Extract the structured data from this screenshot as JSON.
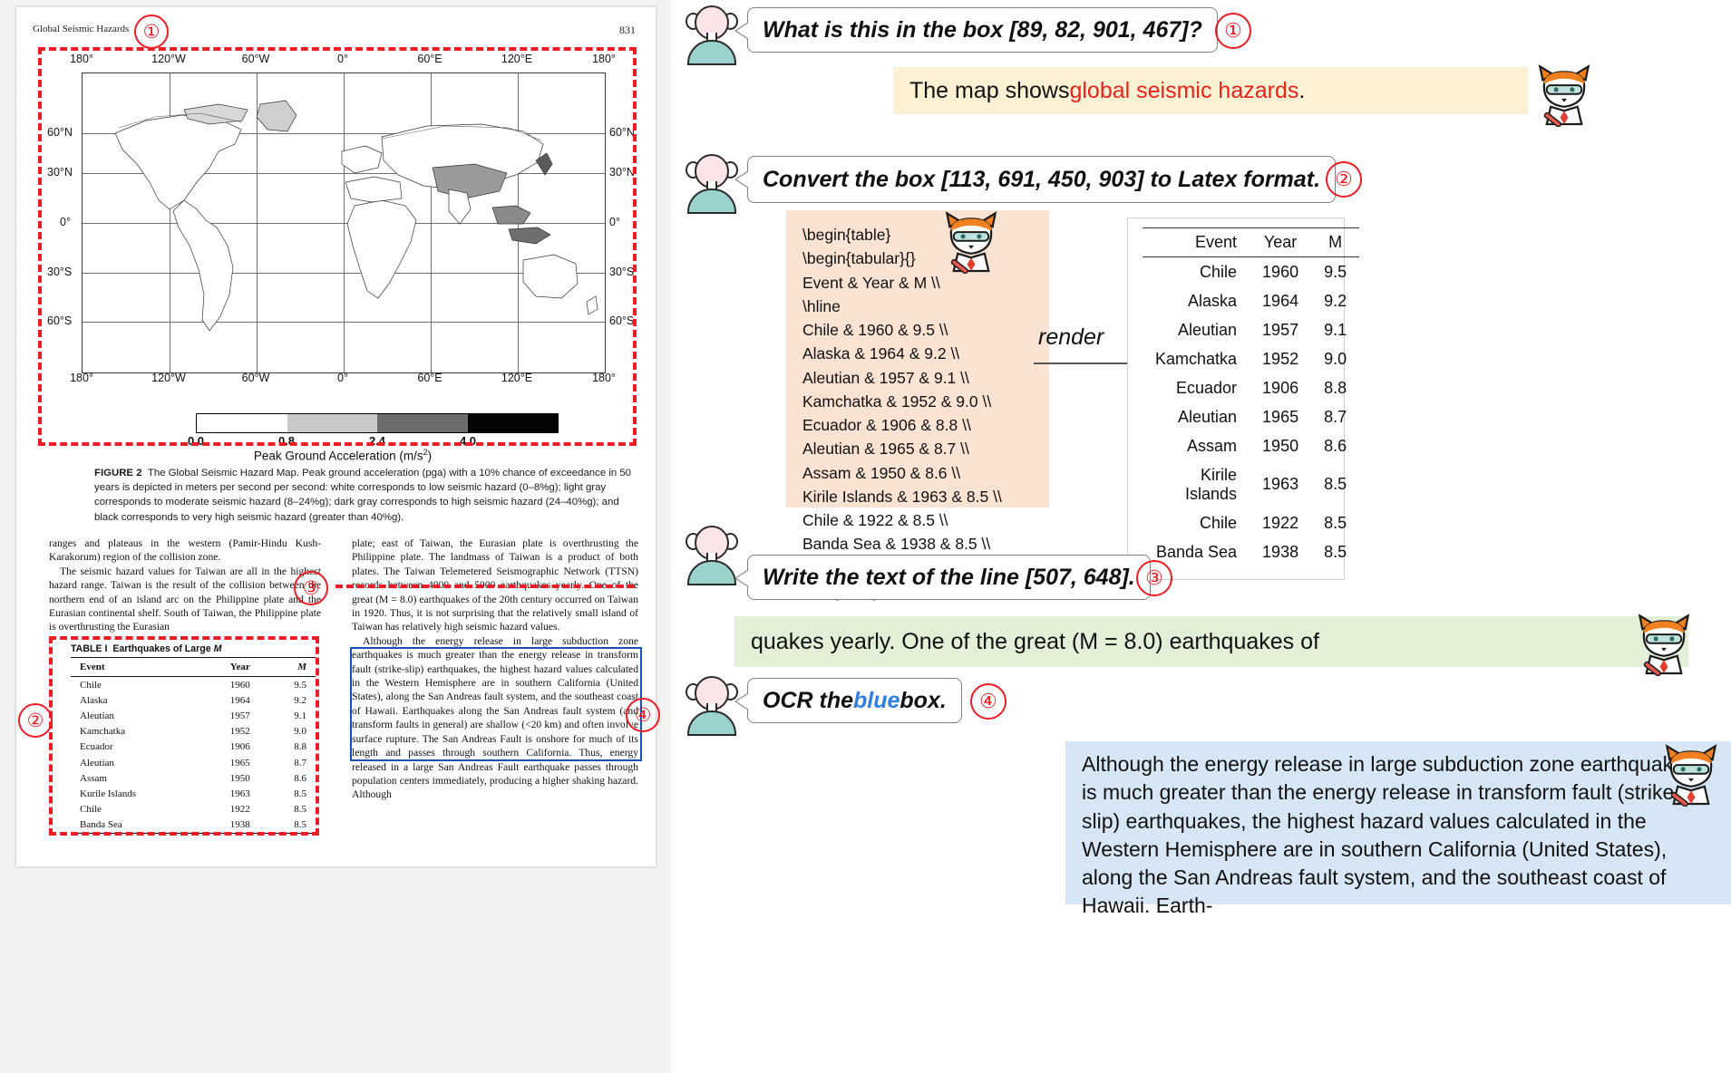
{
  "document": {
    "running_head": "Global Seismic Hazards",
    "page_number": "831",
    "figure": {
      "lon_labels": [
        "180°",
        "120°W",
        "60°W",
        "0°",
        "60°E",
        "120°E",
        "180°"
      ],
      "lat_labels_left": [
        "60°N",
        "30°N",
        "0°",
        "30°S",
        "60°S"
      ],
      "lat_labels_right": [
        "60°N",
        "30°N",
        "0°",
        "30°S",
        "60°S"
      ],
      "colorbar_ticks": [
        "0.0",
        "0.8",
        "2.4",
        "4.0"
      ],
      "colorbar_title": "Peak Ground Acceleration (m/s",
      "colorbar_title_sup": "2",
      "colorbar_title_end": ")",
      "caption_label": "FIGURE 2",
      "caption_text": "The Global Seismic Hazard Map. Peak ground acceleration (pga) with a 10% chance of exceedance in 50 years is depicted in meters per second per second: white corresponds to low seismic hazard (0–8%g); light gray corresponds to moderate seismic hazard (8–24%g); dark gray corresponds to high seismic hazard (24–40%g); and black corresponds to very high seismic hazard (greater than 40%g)."
    },
    "column_left": [
      "ranges and plateaus in the western (Pamir-Hindu Kush-Karakorum) region of the collision zone.",
      "The seismic hazard values for Taiwan are all in the highest hazard range. Taiwan is the result of the collision between the northern end of an island arc on the Philippine plate and the Eurasian continental shelf. South of Taiwan, the Philippine plate is overthrusting the Eurasian"
    ],
    "column_right": [
      "plate; east of Taiwan, the Eurasian plate is overthrusting the Philippine plate. The landmass of Taiwan is a product of both plates. The Taiwan Telemetered Seismographic Network (TTSN) records between 4000 and 5000 earthquakes yearly. One of the great (M = 8.0) earthquakes of the 20th century occurred on Taiwan in 1920. Thus, it is not surprising that the relatively small island of Taiwan has relatively high seismic hazard values.",
      "Although the energy release in large subduction zone earthquakes is much greater than the energy release in transform fault (strike-slip) earthquakes, the highest hazard values calculated in the Western Hemisphere are in southern California (United States), along the San Andreas fault system, and the southeast coast of Hawaii. Earthquakes along the San Andreas fault system (and transform faults in general) are shallow (<20 km) and often involve surface rupture. The San Andreas Fault is onshore for much of its length and passes through southern California. Thus, energy released in a large San Andreas Fault earthquake passes through population centers immediately, producing a higher shaking hazard. Although"
    ],
    "table": {
      "caption_prefix": "TABLE I",
      "caption_text": "Earthquakes of Large ",
      "caption_italic": "M",
      "headers": [
        "Event",
        "Year",
        "M"
      ],
      "rows": [
        [
          "Chile",
          "1960",
          "9.5"
        ],
        [
          "Alaska",
          "1964",
          "9.2"
        ],
        [
          "Aleutian",
          "1957",
          "9.1"
        ],
        [
          "Kamchatka",
          "1952",
          "9.0"
        ],
        [
          "Ecuador",
          "1906",
          "8.8"
        ],
        [
          "Aleutian",
          "1965",
          "8.7"
        ],
        [
          "Assam",
          "1950",
          "8.6"
        ],
        [
          "Kurile Islands",
          "1963",
          "8.5"
        ],
        [
          "Chile",
          "1922",
          "8.5"
        ],
        [
          "Banda Sea",
          "1938",
          "8.5"
        ]
      ]
    },
    "markers": [
      "①",
      "②",
      "③",
      "④"
    ]
  },
  "chat": {
    "turn1": {
      "marker": "①",
      "question": "What is this in the box [89, 82, 901, 467]?",
      "answer_prefix": "The map shows ",
      "answer_highlight": "global seismic hazards",
      "answer_suffix": "."
    },
    "turn2": {
      "marker": "②",
      "question": "Convert the box [113, 691, 450, 903] to Latex format.",
      "code": "\\begin{table}\n\\begin{tabular}{}\nEvent & Year & M \\\\\n\\hline\nChile & 1960 & 9.5 \\\\\nAlaska & 1964 & 9.2 \\\\\nAleutian & 1957 & 9.1 \\\\\nKamchatka & 1952 & 9.0 \\\\\nEcuador & 1906 & 8.8 \\\\\nAleutian & 1965 & 8.7 \\\\\nAssam & 1950 & 8.6 \\\\\nKirile Islands & 1963 & 8.5 \\\\\nChile & 1922 & 8.5 \\\\\nBanda Sea & 1938 & 8.5 \\\\\n\\end{tabular}\n\\end{table}",
      "render_label": "render",
      "rendered_table": {
        "headers": [
          "Event",
          "Year",
          "M"
        ],
        "rows": [
          [
            "Chile",
            "1960",
            "9.5"
          ],
          [
            "Alaska",
            "1964",
            "9.2"
          ],
          [
            "Aleutian",
            "1957",
            "9.1"
          ],
          [
            "Kamchatka",
            "1952",
            "9.0"
          ],
          [
            "Ecuador",
            "1906",
            "8.8"
          ],
          [
            "Aleutian",
            "1965",
            "8.7"
          ],
          [
            "Assam",
            "1950",
            "8.6"
          ],
          [
            "Kirile Islands",
            "1963",
            "8.5"
          ],
          [
            "Chile",
            "1922",
            "8.5"
          ],
          [
            "Banda Sea",
            "1938",
            "8.5"
          ]
        ]
      }
    },
    "turn3": {
      "marker": "③",
      "question": "Write the text of the line [507, 648].",
      "answer": "quakes yearly. One of the great (M = 8.0) earthquakes of"
    },
    "turn4": {
      "marker": "④",
      "question_prefix": "OCR the ",
      "question_highlight": "blue",
      "question_suffix": " box.",
      "answer": "Although the energy release in large subduction zone earthquakes is much greater than the energy release in transform fault (strike-slip) earthquakes, the highest hazard values calculated in the Western Hemisphere are in southern California (United States), along the San Andreas fault system, and the southeast coast of Hawaii. Earth-"
    }
  },
  "colors": {
    "red_box": "#ee1c24",
    "blue_box": "#1a4fb4",
    "answer_yellow": "#fdf1d4",
    "answer_green": "#e4efd8",
    "answer_blue": "#d6e6f4",
    "code_bg": "#fbe3d3",
    "accent_red_text": "#e8231b",
    "accent_blue_text": "#2f7fe0"
  }
}
